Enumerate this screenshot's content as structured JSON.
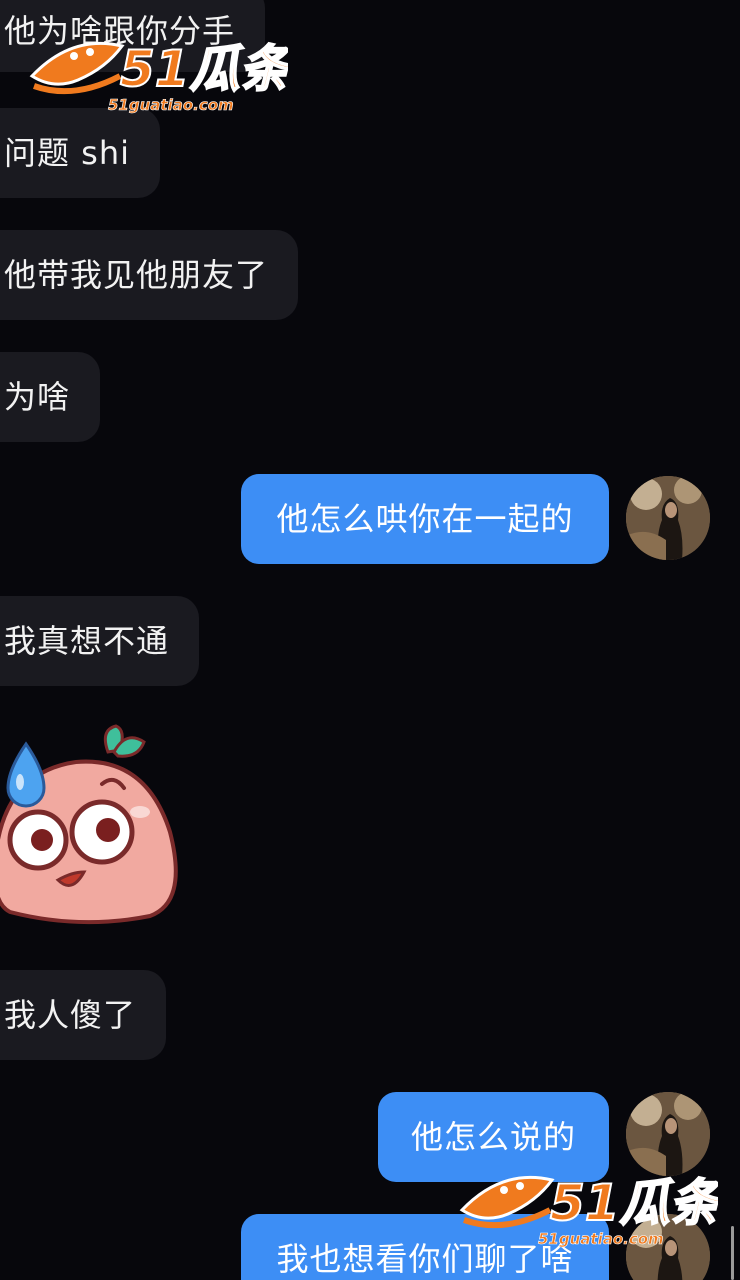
{
  "messages": [
    {
      "side": "in",
      "text": "他为啥跟你分手"
    },
    {
      "side": "in",
      "text": "问题 shi"
    },
    {
      "side": "in",
      "text": "他带我见他朋友了"
    },
    {
      "side": "in",
      "text": "为啥"
    },
    {
      "side": "out",
      "text": "他怎么哄你在一起的"
    },
    {
      "side": "in",
      "text": "我真想不通"
    },
    {
      "side": "in",
      "sticker": "sweating-peach-emoji-sticker"
    },
    {
      "side": "in",
      "text": "我人傻了"
    },
    {
      "side": "out",
      "text": "他怎么说的"
    },
    {
      "side": "out",
      "text": "我也想看你们聊了啥"
    }
  ],
  "watermark": {
    "brand": "51瓜条",
    "url": "51guatiao.com",
    "color": "#f07a1e"
  },
  "colors": {
    "background": "#07070c",
    "incoming_bubble": "#1a1a20",
    "outgoing_bubble": "#3d8ef5"
  }
}
